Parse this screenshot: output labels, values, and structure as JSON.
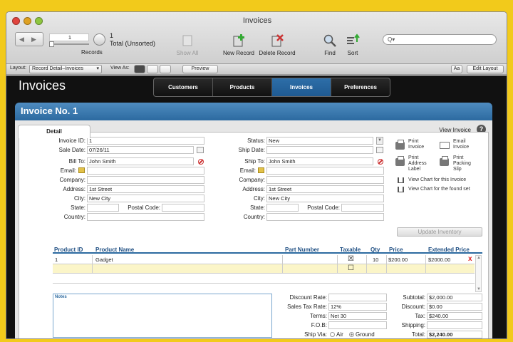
{
  "window": {
    "title": "Invoices"
  },
  "toolbar": {
    "record_value": "1",
    "record_count": "1",
    "sort_status": "Total (Unsorted)",
    "records_label": "Records",
    "show_all": "Show All",
    "new_record": "New Record",
    "delete_record": "Delete Record",
    "find": "Find",
    "sort": "Sort",
    "search_placeholder": "Q▾"
  },
  "layoutbar": {
    "layout_label": "Layout:",
    "layout_value": "Record Detail–Invoices",
    "view_as": "View As:",
    "preview": "Preview",
    "aa": "Aa",
    "edit_layout": "Edit Layout"
  },
  "app": {
    "title": "Invoices",
    "tabs": [
      "Customers",
      "Products",
      "Invoices",
      "Preferences"
    ],
    "active_tab": "Invoices"
  },
  "invoice": {
    "heading": "Invoice No. 1",
    "detail_tab": "Detail",
    "view_invoice": "View Invoice",
    "help": "?"
  },
  "left": {
    "invoice_id_l": "Invoice ID:",
    "invoice_id": "1",
    "sale_date_l": "Sale Date:",
    "sale_date": "07/26/11",
    "bill_to_l": "Bill To:",
    "bill_to": "John Smith",
    "email_l": "Email:",
    "email": "",
    "company_l": "Company:",
    "company": "",
    "address_l": "Address:",
    "address": "1st Street",
    "city_l": "City:",
    "city": "New City",
    "state_l": "State:",
    "state": "",
    "postal_l": "Postal Code:",
    "postal": "",
    "country_l": "Country:",
    "country": ""
  },
  "right": {
    "status_l": "Status:",
    "status": "New",
    "ship_date_l": "Ship Date:",
    "ship_date": "",
    "ship_to_l": "Ship To:",
    "ship_to": "John Smith",
    "email_l": "Email:",
    "email": "",
    "company_l": "Company:",
    "company": "",
    "address_l": "Address:",
    "address": "1st Street",
    "city_l": "City:",
    "city": "New City",
    "state_l": "State:",
    "state": "",
    "postal_l": "Postal Code:",
    "postal": "",
    "country_l": "Country:",
    "country": ""
  },
  "side": {
    "print_invoice": "Print\nInvoice",
    "email_invoice": "Email\nInvoice",
    "print_label": "Print\nAddress\nLabel",
    "print_slip": "Print\nPacking\nSlip",
    "chart_invoice": "View Chart for this Invoice",
    "chart_found": "View Chart for the found set",
    "update_inventory": "Update Inventory"
  },
  "products": {
    "headers": [
      "Product ID",
      "Product Name",
      "Part Number",
      "Taxable",
      "Qty",
      "Price",
      "Extended Price"
    ],
    "rows": [
      {
        "id": "1",
        "name": "Gadget",
        "part": "",
        "taxable": "☒",
        "qty": "10",
        "price": "$200.00",
        "extended": "$2000.00"
      },
      {
        "id": "",
        "name": "",
        "part": "",
        "taxable": "☐",
        "qty": "",
        "price": "",
        "extended": ""
      }
    ],
    "delete": "x"
  },
  "notes": {
    "label": "Notes"
  },
  "totals_left": {
    "discount_rate_l": "Discount Rate:",
    "discount_rate": "",
    "sales_tax_l": "Sales Tax Rate:",
    "sales_tax": "12%",
    "terms_l": "Terms:",
    "terms": "Net 30",
    "fob_l": "F.O.B:",
    "fob": "",
    "ship_via_l": "Ship Via:",
    "air": "Air",
    "ground": "Ground"
  },
  "totals_right": {
    "subtotal_l": "Subtotal:",
    "subtotal": "$2,000.00",
    "discount_l": "Discount:",
    "discount": "$0.00",
    "tax_l": "Tax:",
    "tax": "$240.00",
    "shipping_l": "Shipping:",
    "shipping": "",
    "total_l": "Total:",
    "total": "$2,240.00"
  },
  "colors": {
    "accent": "#2c6aa0",
    "frame": "#f2ca1b",
    "dark": "#111111"
  }
}
